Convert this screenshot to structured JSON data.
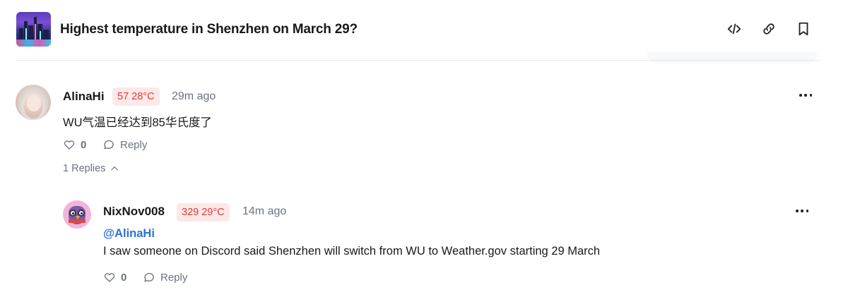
{
  "market": {
    "title": "Highest temperature in Shenzhen on March 29?",
    "thumbnail_icon": "shenzhen-city-night-thumbnail"
  },
  "header_actions": [
    {
      "icon": "code-icon"
    },
    {
      "icon": "link-icon"
    },
    {
      "icon": "bookmark-icon"
    }
  ],
  "comments": [
    {
      "username": "AlinaHi",
      "badge": "57 28°C",
      "time": "29m ago",
      "text": "WU气温已经达到85华氏度了",
      "likes": "0",
      "reply_label": "Reply",
      "replies_toggle": "1 Replies",
      "replies": [
        {
          "username": "NixNov008",
          "badge": "329 29°C",
          "time": "14m ago",
          "mention": "@AlinaHi",
          "text": "I saw someone on Discord said Shenzhen will switch from WU to Weather.gov starting 29 March",
          "likes": "0",
          "reply_label": "Reply"
        }
      ]
    }
  ],
  "colors": {
    "badge_bg": "#fde8e8",
    "badge_text": "#e03b3b",
    "mention": "#2e6fd9",
    "muted": "#6b7280"
  }
}
